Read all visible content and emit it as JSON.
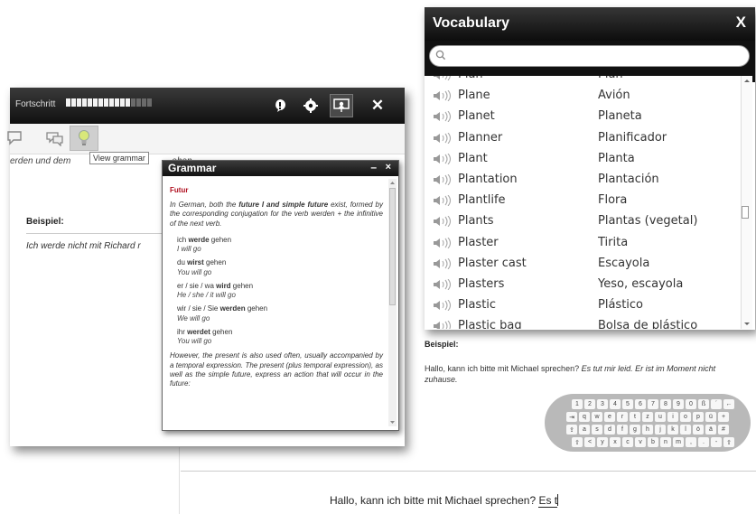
{
  "lesson": {
    "progress_label": "Fortschritt",
    "progress": {
      "filled": 12,
      "total": 16
    },
    "toolbar_icons": [
      "info-icon",
      "settings-icon",
      "presentation-icon",
      "close-icon"
    ],
    "tool_icons": [
      "speech-bubble-icon",
      "chat-icon",
      "lightbulb-icon"
    ],
    "tooltip": "View grammar",
    "snippet": "erden und dem",
    "snippet_hidden": "ehen",
    "example_heading": "Beispiel:",
    "example_sentence": "Ich werde nicht mit Richard r"
  },
  "grammar": {
    "title": "Grammar",
    "minimize": "–",
    "close": "×",
    "subtitle": "Futur",
    "intro": {
      "a": "In German, both the ",
      "b": "future I and simple future",
      "c": " exist, formed by the corresponding conjugation for the verb werden + the infinitive of the next verb."
    },
    "conjugations": [
      {
        "pre": "ich ",
        "verb": "werde",
        "post": " gehen",
        "en": "I will go"
      },
      {
        "pre": "du ",
        "verb": "wirst",
        "post": " gehen",
        "en": "You will go"
      },
      {
        "pre": "er / sie / wa ",
        "verb": "wird",
        "post": " gehen",
        "en": "He / she / it will go"
      },
      {
        "pre": "wir / sie / Sie ",
        "verb": "werden",
        "post": " gehen",
        "en": "We will go"
      },
      {
        "pre": "ihr ",
        "verb": "werdet",
        "post": " gehen",
        "en": "You will go"
      }
    ],
    "outro": "However, the present is also used often, usually accompanied by a temporal expression. The present (plus temporal expression), as well as the simple future, express an action that will occur in the future:"
  },
  "vocabulary": {
    "title": "Vocabulary",
    "close": "X",
    "search_placeholder": "",
    "rows": [
      {
        "de": "Plan",
        "es": "Plan"
      },
      {
        "de": "Plane",
        "es": "Avión"
      },
      {
        "de": "Planet",
        "es": "Planeta"
      },
      {
        "de": "Planner",
        "es": "Planificador"
      },
      {
        "de": "Plant",
        "es": "Planta"
      },
      {
        "de": "Plantation",
        "es": "Plantación"
      },
      {
        "de": "Plantlife",
        "es": "Flora"
      },
      {
        "de": "Plants",
        "es": "Plantas (vegetal)"
      },
      {
        "de": "Plaster",
        "es": "Tirita"
      },
      {
        "de": "Plaster cast",
        "es": "Escayola"
      },
      {
        "de": "Plasters",
        "es": "Yeso, escayola"
      },
      {
        "de": "Plastic",
        "es": "Plástico"
      },
      {
        "de": "Plastic bag",
        "es": "Bolsa de plástico"
      }
    ]
  },
  "page": {
    "example_heading": "Beispiel:",
    "example_plain": "Hallo, kann ich bitte mit Michael sprechen? ",
    "example_italic": "Es tut mir leid. Er ist im Moment nicht zuhause.",
    "answer_prefix": "Hallo, kann ich bitte mit Michael sprechen? ",
    "answer_typed": "Es t"
  },
  "keyboard": {
    "rows": [
      [
        "1",
        "2",
        "3",
        "4",
        "5",
        "6",
        "7",
        "8",
        "9",
        "0",
        "ß",
        "´",
        "←"
      ],
      [
        "⇥",
        "q",
        "w",
        "e",
        "r",
        "t",
        "z",
        "u",
        "i",
        "o",
        "p",
        "ü",
        "+"
      ],
      [
        "⇪",
        "a",
        "s",
        "d",
        "f",
        "g",
        "h",
        "j",
        "k",
        "l",
        "ö",
        "ä",
        "#"
      ],
      [
        "⇧",
        "<",
        "y",
        "x",
        "c",
        "v",
        "b",
        "n",
        "m",
        ",",
        ".",
        "-",
        "⇧"
      ]
    ]
  }
}
